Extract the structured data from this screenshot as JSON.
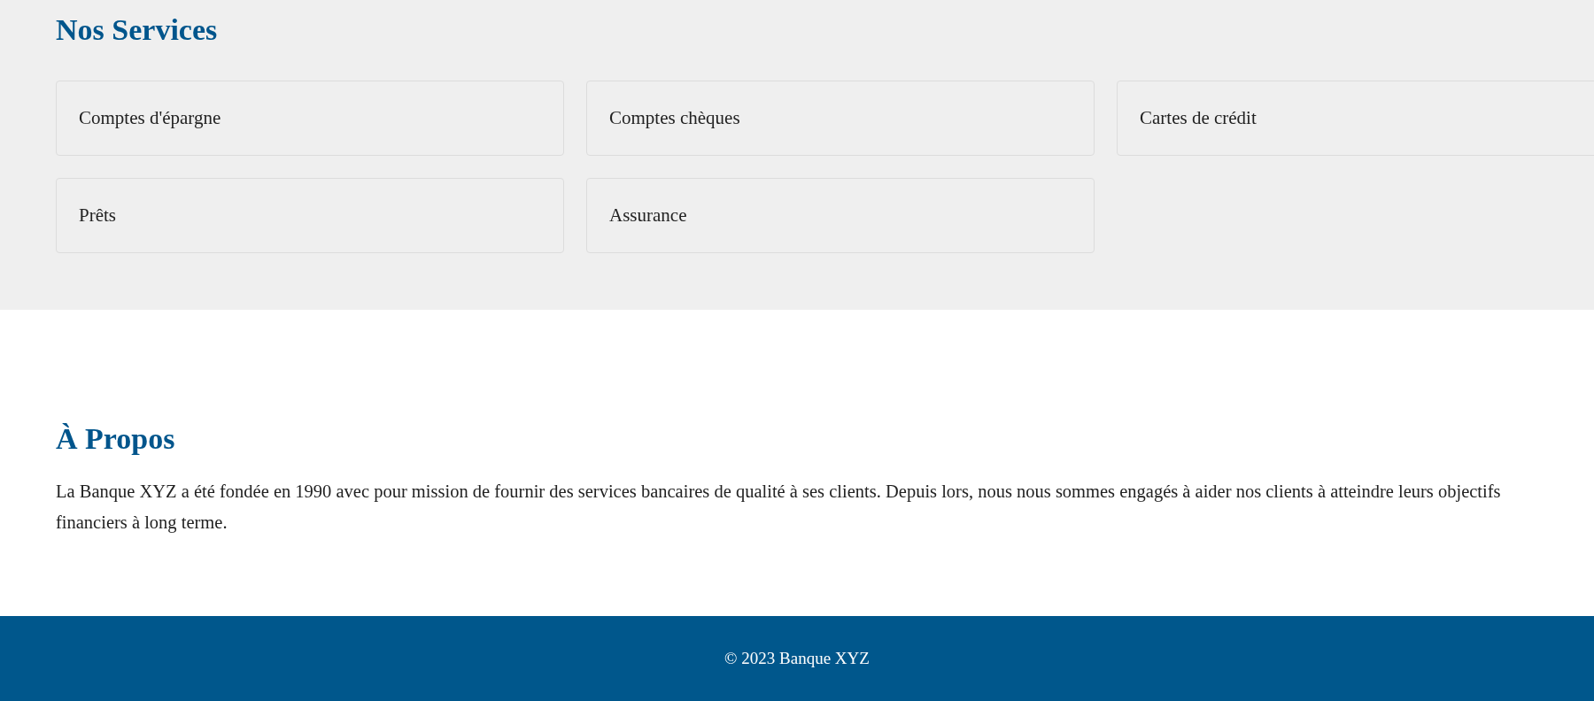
{
  "services": {
    "title": "Nos Services",
    "items": [
      {
        "label": "Comptes d'épargne"
      },
      {
        "label": "Comptes chèques"
      },
      {
        "label": "Cartes de crédit"
      },
      {
        "label": "Prêts"
      },
      {
        "label": "Assurance"
      }
    ]
  },
  "about": {
    "title": "À Propos",
    "text": "La Banque XYZ a été fondée en 1990 avec pour mission de fournir des services bancaires de qualité à ses clients. Depuis lors, nous nous sommes engagés à aider nos clients à atteindre leurs objectifs financiers à long terme."
  },
  "footer": {
    "text": "© 2023 Banque XYZ"
  }
}
